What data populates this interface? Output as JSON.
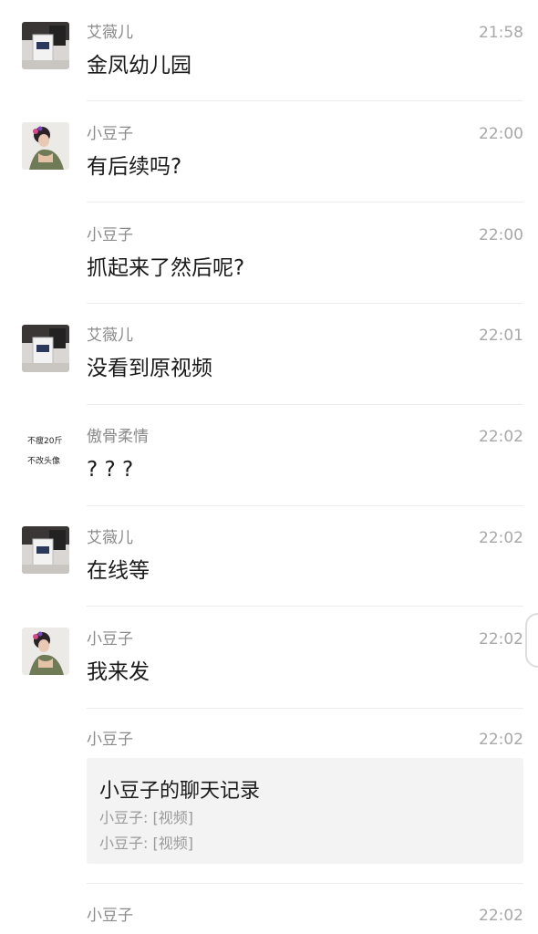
{
  "messages": [
    {
      "sender": "艾薇儿",
      "time": "21:58",
      "text": "金凤幼儿园",
      "avatar": "cup-photo-avatar"
    },
    {
      "sender": "小豆子",
      "time": "22:00",
      "text": "有后续吗?",
      "avatar": "woman-photo-avatar"
    },
    {
      "sender": "小豆子",
      "time": "22:00",
      "text": "抓起来了然后呢?",
      "avatar": "none"
    },
    {
      "sender": "艾薇儿",
      "time": "22:01",
      "text": "没看到原视频",
      "avatar": "cup-photo-avatar"
    },
    {
      "sender": "傲骨柔情",
      "time": "22:02",
      "text": "? ? ?",
      "avatar": "text-avatar",
      "avatar_text": [
        "不瘦20斤",
        "不改头像"
      ]
    },
    {
      "sender": "艾薇儿",
      "time": "22:02",
      "text": "在线等",
      "avatar": "cup-photo-avatar"
    },
    {
      "sender": "小豆子",
      "time": "22:02",
      "text": "我来发",
      "avatar": "woman-photo-avatar"
    },
    {
      "sender": "小豆子",
      "time": "22:02",
      "avatar": "none",
      "card": {
        "title": "小豆子的聊天记录",
        "lines": [
          "小豆子: [视频]",
          "小豆子: [视频]"
        ]
      }
    },
    {
      "sender": "小豆子",
      "time": "22:02",
      "avatar": "none"
    }
  ]
}
